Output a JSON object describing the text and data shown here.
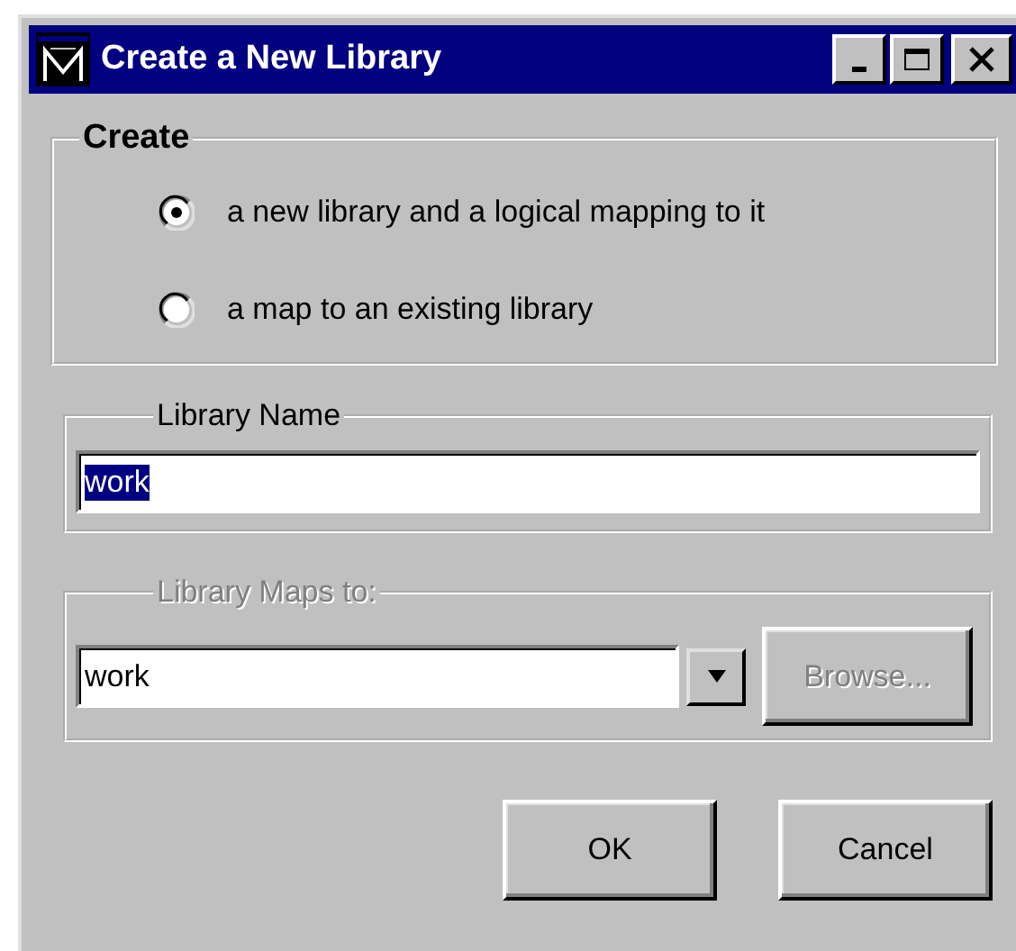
{
  "window": {
    "title": "Create a New Library",
    "active": true
  },
  "title_buttons": [
    {
      "kind": "minimize"
    },
    {
      "kind": "maximize"
    },
    {
      "kind": "close"
    }
  ],
  "create_group": {
    "label": "Create",
    "options": [
      {
        "label": "a new library and a logical mapping to it",
        "selected": true
      },
      {
        "label": "a map to an existing library",
        "selected": false
      }
    ]
  },
  "library_name": {
    "label": "Library Name",
    "value": "work",
    "text_selected": true
  },
  "library_maps_to": {
    "label": "Library Maps to:",
    "disabled": true,
    "value": "work",
    "browse_button": {
      "label": "Browse...",
      "disabled": true
    }
  },
  "buttons": [
    {
      "label": "OK"
    },
    {
      "label": "Cancel"
    }
  ]
}
